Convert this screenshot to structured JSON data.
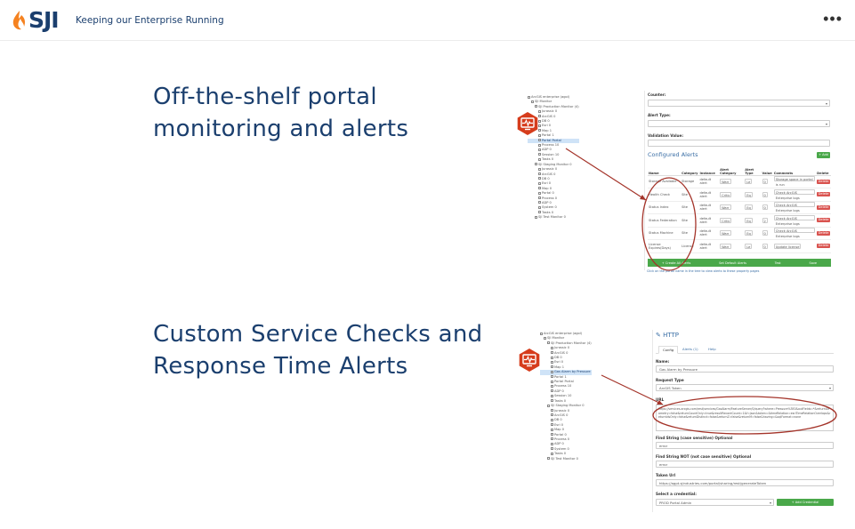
{
  "header": {
    "logo_text": "SJI",
    "tagline": "Keeping our Enterprise Running",
    "more_label": "•••"
  },
  "sections": [
    {
      "title": "Off-the-shelf portal monitoring and alerts"
    },
    {
      "title": "Custom Service Checks and Response Time Alerts"
    }
  ],
  "colors": {
    "brand_navy": "#1b3f6e",
    "brand_orange": "#f58220",
    "icon_red": "#d63c1c",
    "accent_green": "#4aa84a",
    "annotation_red": "#a4342a"
  },
  "icons": {
    "section_badge": "monitor-pulse-icon",
    "more": "more-dots-icon"
  },
  "alerts_screen": {
    "tree": [
      "ArcGIS enterprise (agol)",
      "SJI Monitor",
      "SJI Production Monitor (4)",
      "Jurassic 0",
      "ArcGIS 0",
      "DB 0",
      "Esri 0",
      "Map 1",
      "Portal 1",
      "Portal Portal",
      "Process 10",
      "ADP 0",
      "Session 10",
      "Tasks 0",
      "SJI Staging Monitor 0",
      "Jurassic 0",
      "ArcGIS 0",
      "DB 0",
      "Esri 0",
      "Map 0",
      "Portal 0",
      "Process 0",
      "ADP 0",
      "System 0",
      "Tasks 0",
      "SJI Test Monitor 0"
    ],
    "tree_selected_index": 9,
    "fields": [
      {
        "label": "Counter:",
        "value": ""
      },
      {
        "label": "Alert Type:",
        "value": ""
      },
      {
        "label": "Validation Value:",
        "value": ""
      }
    ],
    "configured_title": "Configured Alerts",
    "add_label": "+ Add",
    "columns": [
      "Name",
      "Category",
      "Instance",
      "Alert Category",
      "Alert Type",
      "Value",
      "Comments",
      "Delete"
    ],
    "rows": [
      [
        "Storage Available",
        "Storage",
        "default alert",
        "Warr",
        "Le",
        "0",
        "Storage space in portal is run"
      ],
      [
        "Health Check",
        "Site",
        "default alert",
        "Critic",
        "Eq",
        "0",
        "Check ArcGIS Enterprise logs"
      ],
      [
        "Status Index",
        "Site",
        "default alert",
        "Warr",
        "Eq",
        "0",
        "Check ArcGIS Enterprise logs"
      ],
      [
        "Status Federation",
        "Site",
        "default alert",
        "Critic",
        "Eq",
        "2",
        "Check ArcGIS Enterprise logs"
      ],
      [
        "Status Machine",
        "Site",
        "default alert",
        "Warr",
        "Eq",
        "0",
        "Check ArcGIS Enterprise logs"
      ],
      [
        "License Expires(Days)",
        "License",
        "default alert",
        "Warr",
        "Le",
        "0",
        "Update license"
      ]
    ],
    "delete_label": "Delete",
    "actions": [
      "+ Create All Alerts",
      "Set Default Alerts",
      "Test",
      "Save"
    ],
    "footnote": "Click on the portal name in the tree to view alerts to these property pages"
  },
  "http_screen": {
    "title": "HTTP",
    "tree": [
      "ArcGIS enterprise (agol)",
      "SJI Monitor",
      "SJI Production Monitor (4)",
      "Jurassic 0",
      "ArcGIS 0",
      "DB 0",
      "Esri 0",
      "Map 1",
      "Gas Alarm by Pressure",
      "Portal 1",
      "Portal Portal",
      "Process 10",
      "ADP 0",
      "Session 10",
      "Tasks 0",
      "SJI Staging Monitor 0",
      "Jurassic 0",
      "ArcGIS 0",
      "DB 0",
      "Esri 0",
      "Map 0",
      "Portal 0",
      "Process 0",
      "ADP 0",
      "System 0",
      "Tasks 0",
      "SJI Test Monitor 0"
    ],
    "tree_selected_index": 8,
    "tabs": [
      "Config",
      "Alerts (1)",
      "Help"
    ],
    "name_label": "Name:",
    "name_value": "Gas Alarm by Pressure",
    "request_label": "Request Type",
    "request_value": "ArcGIS Token",
    "url_label": "URL",
    "url_value": "https://services.arcgis.com/rest/services/GasAlarm/FeatureServer/0/query?where=Pressure%3E0&outFields=*&returnGeometry=false&returnCountOnly=true&resultRecordCount=1&f=json&token=&timeRelation=esriTimeRelationOverlaps&returnIdsOnly=false&returnDistinct=false&returnZ=false&returnM=false&having=&sqlFormat=none",
    "find_label": "Find String (case sensitive) Optional",
    "find_value": "error",
    "find_not_label": "Find String NOT (not case sensitive) Optional",
    "find_not_value": "error",
    "token_label": "Token Url",
    "token_value": "https://agpt.sjindustries.com/portal/sharing/rest/generateToken",
    "cred_label": "Select a credential:",
    "cred_value": "PROD Portal Admin",
    "add_cred_label": "+ Add Credential"
  }
}
